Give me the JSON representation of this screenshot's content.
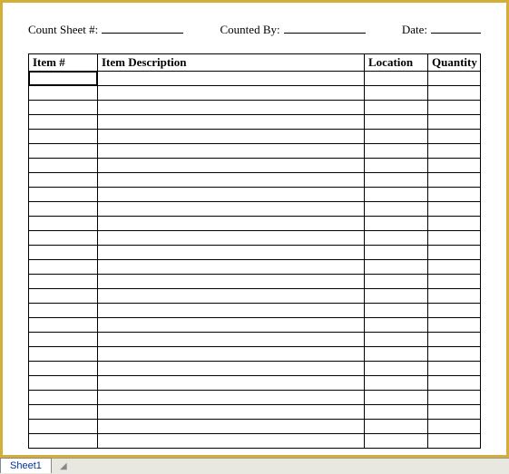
{
  "header": {
    "countSheetLabel": "Count Sheet #:",
    "countedByLabel": "Counted By:",
    "dateLabel": "Date:",
    "countSheetValue": "",
    "countedByValue": "",
    "dateValue": ""
  },
  "table": {
    "columns": [
      "Item #",
      "Item Description",
      "Location",
      "Quantity"
    ],
    "rowCount": 26
  },
  "tabs": {
    "sheet1": "Sheet1"
  }
}
